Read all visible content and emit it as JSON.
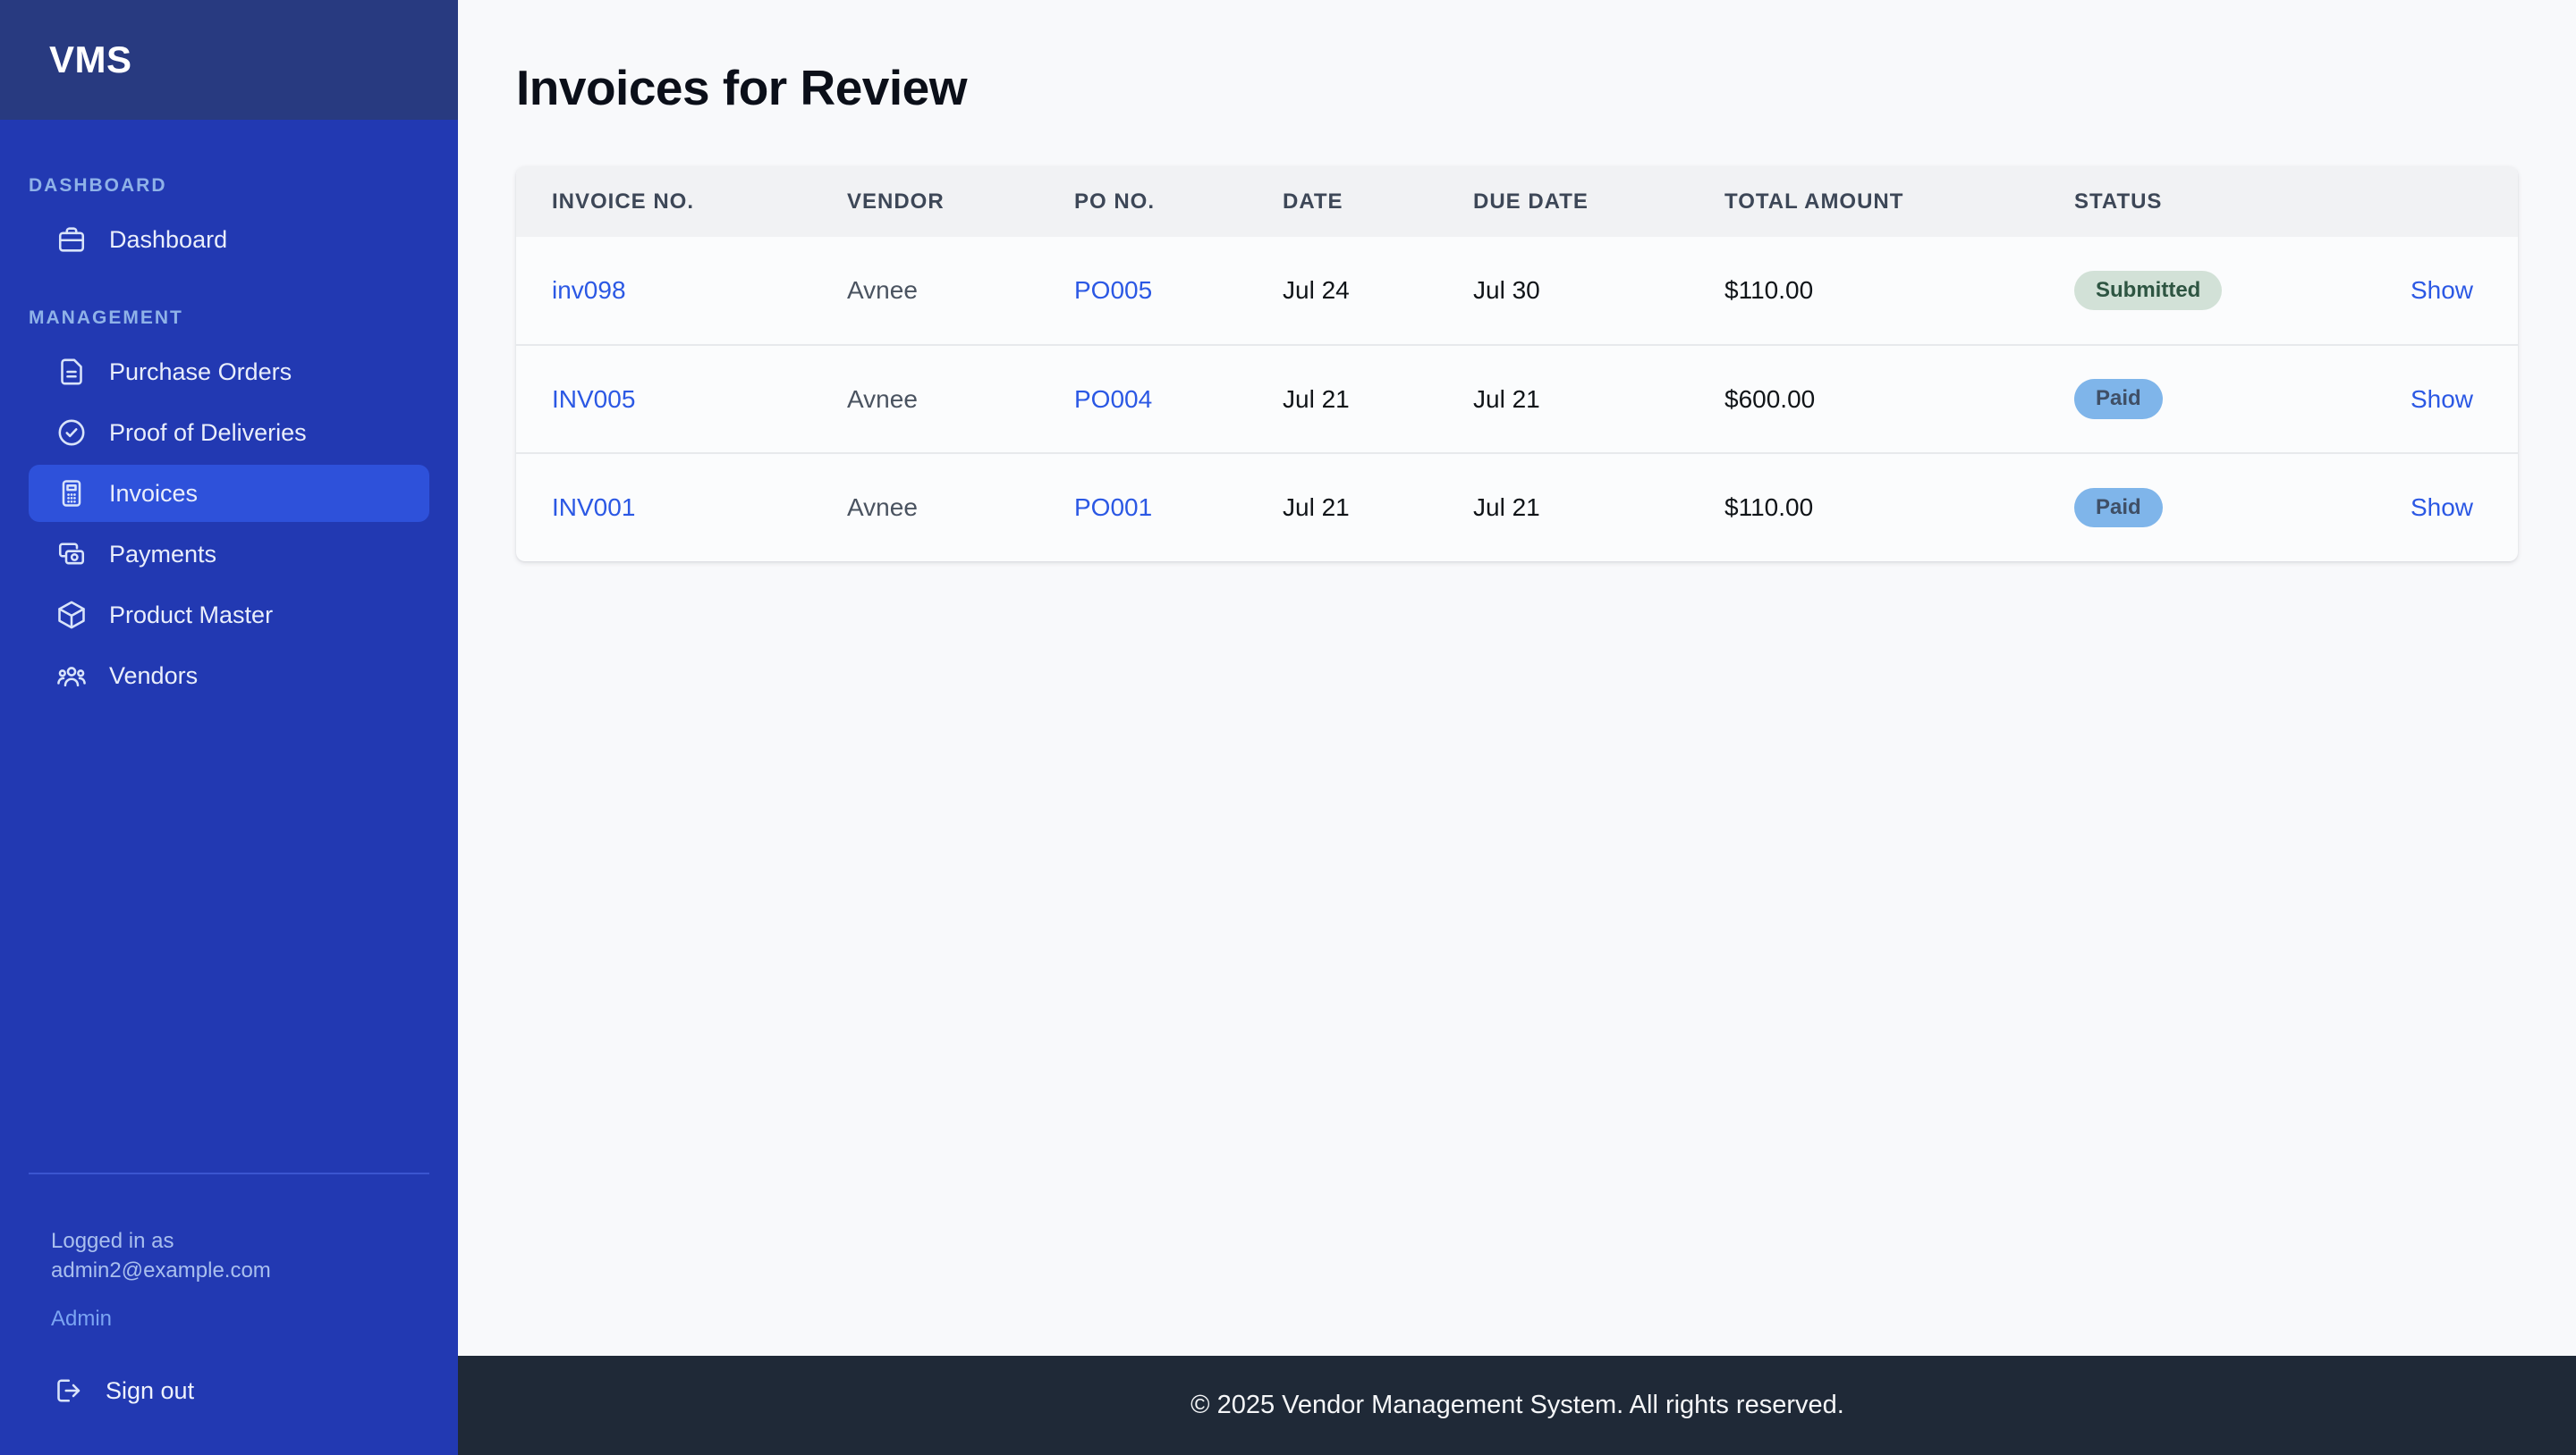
{
  "app": {
    "logo": "VMS"
  },
  "sidebar": {
    "sections": [
      {
        "label": "Dashboard",
        "items": [
          {
            "label": "Dashboard",
            "icon": "briefcase-icon",
            "active": false
          }
        ]
      },
      {
        "label": "Management",
        "items": [
          {
            "label": "Purchase Orders",
            "icon": "document-icon",
            "active": false
          },
          {
            "label": "Proof of Deliveries",
            "icon": "check-circle-icon",
            "active": false
          },
          {
            "label": "Invoices",
            "icon": "calculator-icon",
            "active": true
          },
          {
            "label": "Payments",
            "icon": "banknotes-icon",
            "active": false
          },
          {
            "label": "Product Master",
            "icon": "cube-icon",
            "active": false
          },
          {
            "label": "Vendors",
            "icon": "users-icon",
            "active": false
          }
        ]
      }
    ],
    "user": {
      "logged_in_label": "Logged in as",
      "email": "admin2@example.com",
      "role": "Admin",
      "sign_out_label": "Sign out"
    }
  },
  "main": {
    "title": "Invoices for Review",
    "table": {
      "columns": [
        "Invoice No.",
        "Vendor",
        "PO No.",
        "Date",
        "Due Date",
        "Total Amount",
        "Status",
        ""
      ],
      "rows": [
        {
          "invoice_no": "inv098",
          "vendor": "Avnee",
          "po_no": "PO005",
          "date": "Jul 24",
          "due_date": "Jul 30",
          "total": "$110.00",
          "status": "Submitted",
          "action": "Show"
        },
        {
          "invoice_no": "INV005",
          "vendor": "Avnee",
          "po_no": "PO004",
          "date": "Jul 21",
          "due_date": "Jul 21",
          "total": "$600.00",
          "status": "Paid",
          "action": "Show"
        },
        {
          "invoice_no": "INV001",
          "vendor": "Avnee",
          "po_no": "PO001",
          "date": "Jul 21",
          "due_date": "Jul 21",
          "total": "$110.00",
          "status": "Paid",
          "action": "Show"
        }
      ]
    }
  },
  "footer": {
    "text": "© 2025 Vendor Management System. All rights reserved."
  },
  "colors": {
    "sidebar_bg": "#2239b2",
    "sidebar_header_bg": "#283a80",
    "active_item_bg": "#2e51da",
    "section_label": "#8fb2e8",
    "link": "#2b58e4",
    "badge_submitted_bg": "#d2e1d7",
    "badge_submitted_text": "#2e5542",
    "badge_paid_bg": "#7fb5ea",
    "badge_paid_text": "#3f4f66",
    "footer_bg": "#1f2937",
    "main_bg": "#f8f9fb"
  }
}
